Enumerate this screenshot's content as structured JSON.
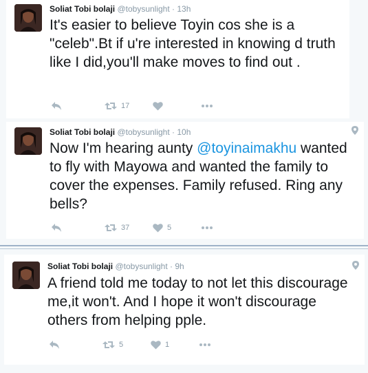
{
  "tweets": [
    {
      "name": "Soliat Tobi bolaji",
      "handle": "@tobysunlight",
      "time": "13h",
      "text": "It's easier to believe Toyin cos she is a \"celeb\".Bt if u're interested in knowing d truth like I did,you'll make moves to find out .",
      "retweets": "17",
      "likes": "",
      "has_location": false
    },
    {
      "name": "Soliat Tobi bolaji",
      "handle": "@tobysunlight",
      "time": "10h",
      "text_before": "Now I'm hearing aunty ",
      "mention": "@toyinaimakhu",
      "text_after": " wanted to fly with Mayowa and wanted the family to cover the expenses. Family refused. Ring any bells?",
      "retweets": "37",
      "likes": "5",
      "has_location": true
    },
    {
      "name": "Soliat Tobi bolaji",
      "handle": "@tobysunlight",
      "time": "9h",
      "text": "A friend told me today to not let this discourage me,it won't. And I hope it won't discourage others from helping pple.",
      "retweets": "5",
      "likes": "1",
      "has_location": true
    }
  ],
  "time_separator": " · ",
  "icons": [
    "reply-icon",
    "retweet-icon",
    "like-icon",
    "more-icon",
    "location-icon"
  ],
  "colors": {
    "mention": "#1b95e0",
    "muted": "#8899a6",
    "background": "#f5f8fa"
  }
}
